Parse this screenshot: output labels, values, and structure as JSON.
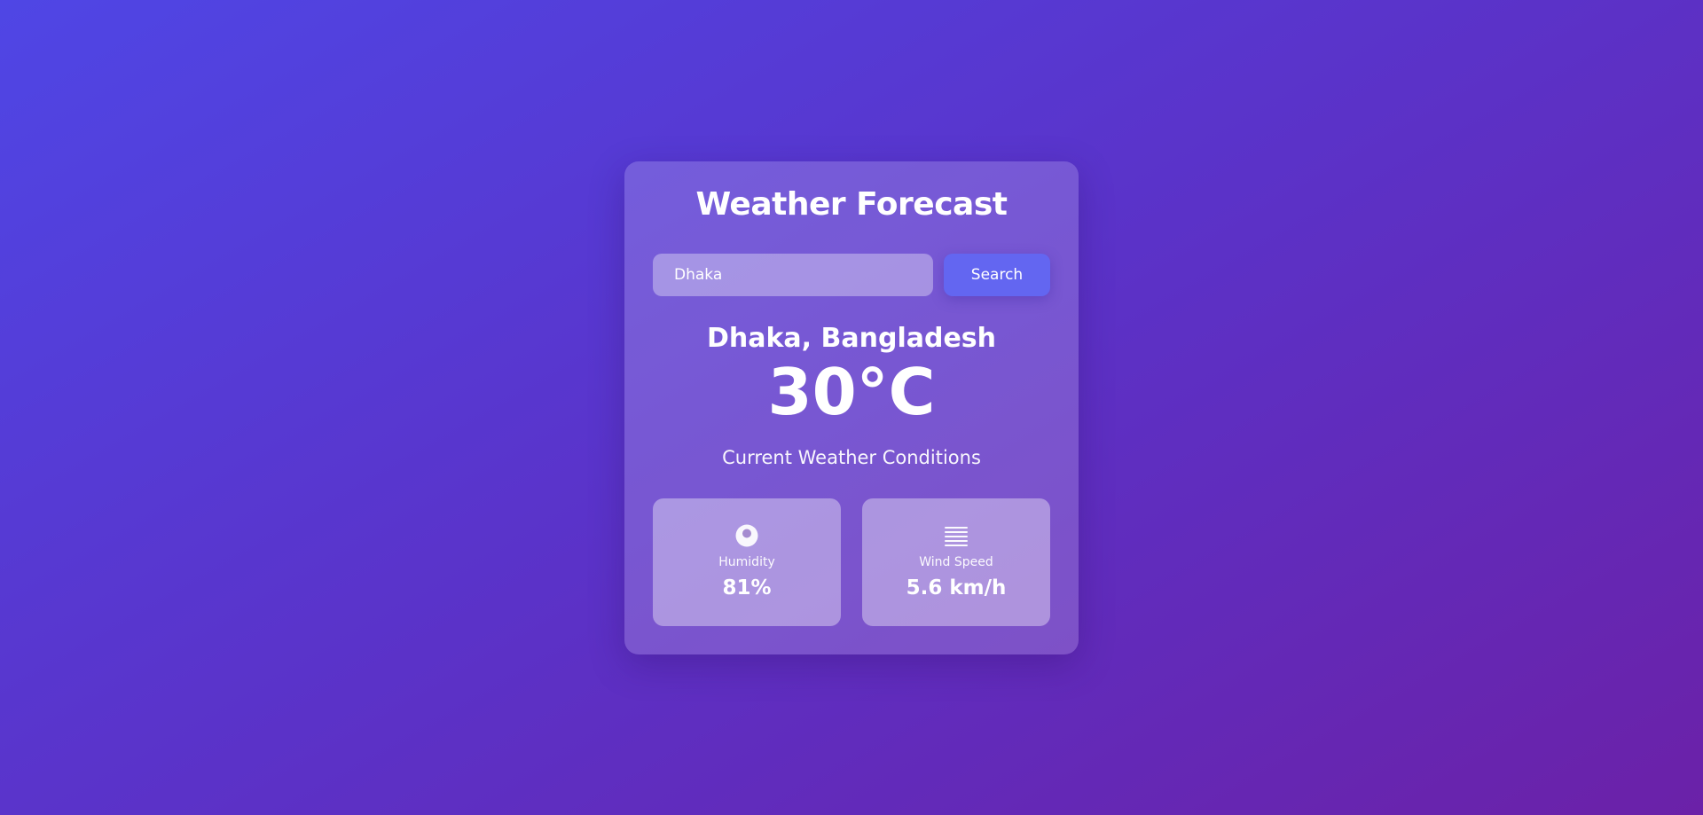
{
  "app": {
    "title": "Weather Forecast"
  },
  "search": {
    "value": "Dhaka",
    "button_label": "Search"
  },
  "weather": {
    "location": "Dhaka, Bangladesh",
    "temperature": "30°C",
    "conditions": "Current Weather Conditions"
  },
  "stats": {
    "humidity": {
      "label": "Humidity",
      "value": "81%",
      "icon": "droplet-icon"
    },
    "wind": {
      "label": "Wind Speed",
      "value": "5.6 km/h",
      "icon": "wind-lines-icon"
    }
  },
  "colors": {
    "background_start": "#4f46e5",
    "background_end": "#6b21a8",
    "accent": "#6366f1",
    "text": "#ffffff"
  }
}
